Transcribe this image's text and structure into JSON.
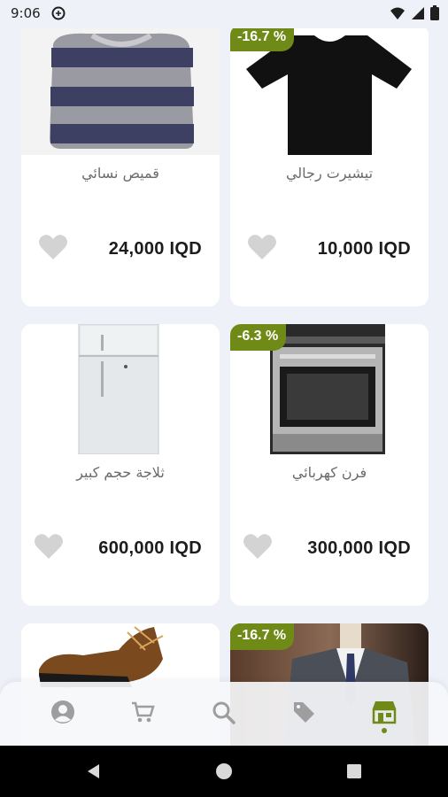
{
  "status_bar": {
    "time": "9:06",
    "icons": [
      "notification-icon",
      "wifi-icon",
      "signal-icon",
      "battery-icon"
    ]
  },
  "products": [
    {
      "title": "قميص نسائي",
      "price": "24,000 IQD",
      "discount": "",
      "image": "sweater"
    },
    {
      "title": "تيشيرت رجالي",
      "price": "10,000 IQD",
      "discount": "-16.7 %",
      "image": "tshirt"
    },
    {
      "title": "ثلاجة حجم كبير",
      "price": "600,000 IQD",
      "discount": "",
      "image": "fridge"
    },
    {
      "title": "فرن كهربائي",
      "price": "300,000 IQD",
      "discount": "-6.3 %",
      "image": "oven"
    },
    {
      "title": "",
      "price": "",
      "discount": "",
      "image": "boots"
    },
    {
      "title": "",
      "price": "",
      "discount": "-16.7 %",
      "image": "suit"
    }
  ],
  "bottom_nav": {
    "items": [
      "profile-icon",
      "cart-icon",
      "search-icon",
      "offers-icon",
      "store-icon"
    ],
    "active": "store-icon"
  },
  "colors": {
    "accent": "#6f8a16",
    "background": "#eef1f8",
    "card": "#ffffff",
    "heart": "#d3d3d3"
  }
}
